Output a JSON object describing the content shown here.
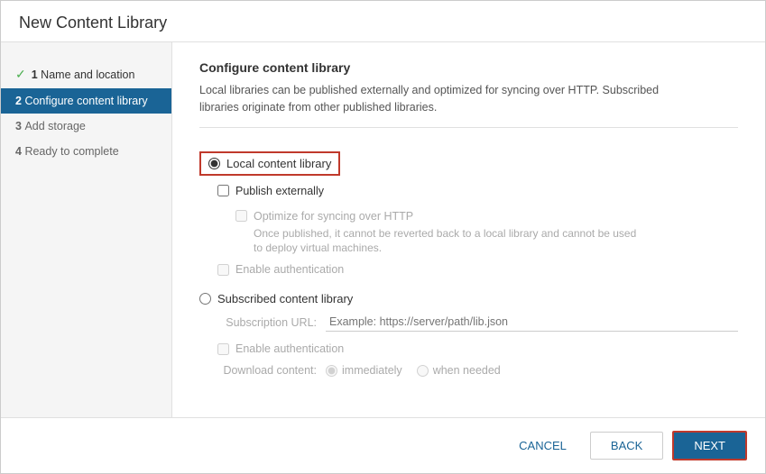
{
  "dialog": {
    "title": "New Content Library"
  },
  "steps": [
    {
      "id": "step-1",
      "number": "1",
      "label": "Name and location",
      "state": "completed"
    },
    {
      "id": "step-2",
      "number": "2",
      "label": "Configure content library",
      "state": "active"
    },
    {
      "id": "step-3",
      "number": "3",
      "label": "Add storage",
      "state": "pending"
    },
    {
      "id": "step-4",
      "number": "4",
      "label": "Ready to complete",
      "state": "pending"
    }
  ],
  "main": {
    "section_title": "Configure content library",
    "description_line1": "Local libraries can be published externally and optimized for syncing over HTTP. Subscribed",
    "description_line2": "libraries originate from other published libraries.",
    "local_library_label": "Local content library",
    "publish_externally_label": "Publish externally",
    "optimize_http_label": "Optimize for syncing over HTTP",
    "optimize_note_line1": "Once published, it cannot be reverted back to a local library and cannot be used",
    "optimize_note_line2": "to deploy virtual machines.",
    "enable_auth_local_label": "Enable authentication",
    "subscribed_library_label": "Subscribed content library",
    "subscription_url_label": "Subscription URL:",
    "subscription_url_placeholder": "Example: https://server/path/lib.json",
    "enable_auth_sub_label": "Enable authentication",
    "download_content_label": "Download content:",
    "immediately_label": "immediately",
    "when_needed_label": "when needed"
  },
  "footer": {
    "cancel_label": "CANCEL",
    "back_label": "BACK",
    "next_label": "NEXT"
  }
}
